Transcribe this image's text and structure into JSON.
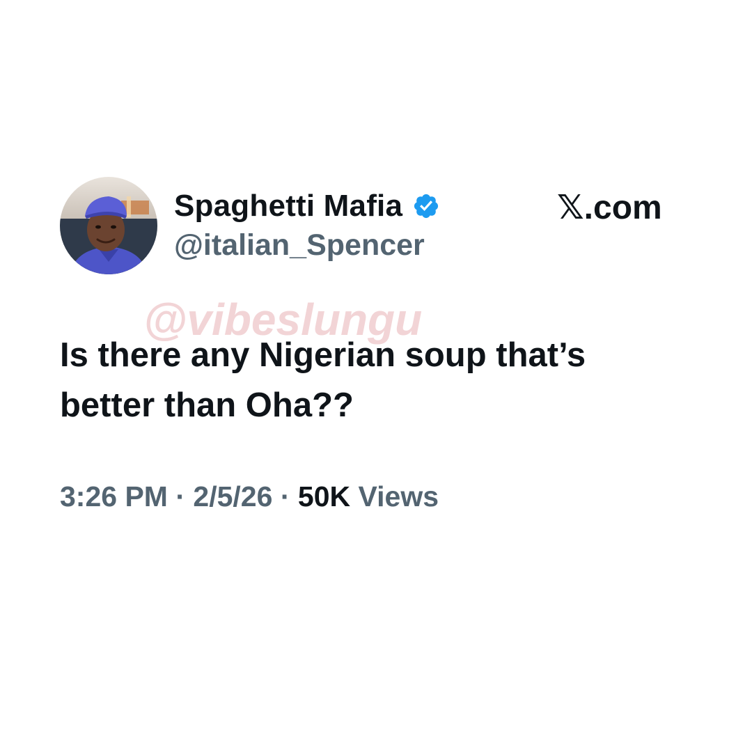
{
  "tweet": {
    "display_name": "Spaghetti Mafia",
    "handle": "@italian_Spencer",
    "verified": true,
    "text": "Is there any Nigerian soup that’s\nbetter than Oha??",
    "time": "3:26 PM",
    "separator": "·",
    "date": "2/5/26",
    "views_count": "50K",
    "views_label": "Views"
  },
  "branding": {
    "site_label": "𝕏.com"
  },
  "watermark": {
    "text": "@vibeslungu"
  },
  "icons": {
    "verified": "verified-badge-icon",
    "avatar": "profile-photo"
  },
  "colors": {
    "verified_blue": "#1d9bf0",
    "text_primary": "#0f1419",
    "text_secondary": "#536471",
    "watermark": "#e2a0a3"
  }
}
